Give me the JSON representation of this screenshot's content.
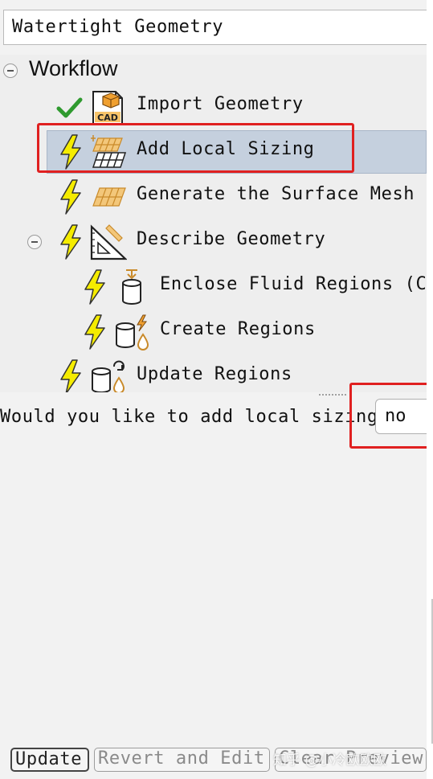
{
  "workflow_selector": {
    "value": "Watertight Geometry"
  },
  "tree": {
    "root_label": "Workflow",
    "items": [
      {
        "label": "Import Geometry",
        "status": "check-icon",
        "tool": "cad-import-icon"
      },
      {
        "label": "Add Local Sizing",
        "status": "lightning-icon",
        "tool": "local-sizing-icon",
        "selected": true
      },
      {
        "label": "Generate the Surface Mesh",
        "status": "lightning-icon",
        "tool": "surface-mesh-icon"
      },
      {
        "label": "Describe Geometry",
        "status": "lightning-icon",
        "tool": "triangle-ruler-icon",
        "expanded": true
      },
      {
        "label": "Enclose Fluid Regions (Capping)",
        "status": "lightning-icon",
        "tool": "capping-cylinder-icon"
      },
      {
        "label": "Create Regions",
        "status": "lightning-icon",
        "tool": "create-regions-icon"
      },
      {
        "label": "Update Regions",
        "status": "lightning-icon",
        "tool": "update-regions-icon"
      }
    ]
  },
  "task": {
    "question": "Would you like to add local sizing?",
    "answer": "no"
  },
  "buttons": {
    "update": "Update",
    "revert": "Revert and Edit",
    "clear": "Clear Preview"
  },
  "watermark": "知乎 @小冷欧欧欧",
  "colors": {
    "selection": "#c5d0de",
    "annotation": "#e02020",
    "lightning": "#f5ec00",
    "check": "#2f9a2f",
    "tool_orange": "#e0a040"
  }
}
